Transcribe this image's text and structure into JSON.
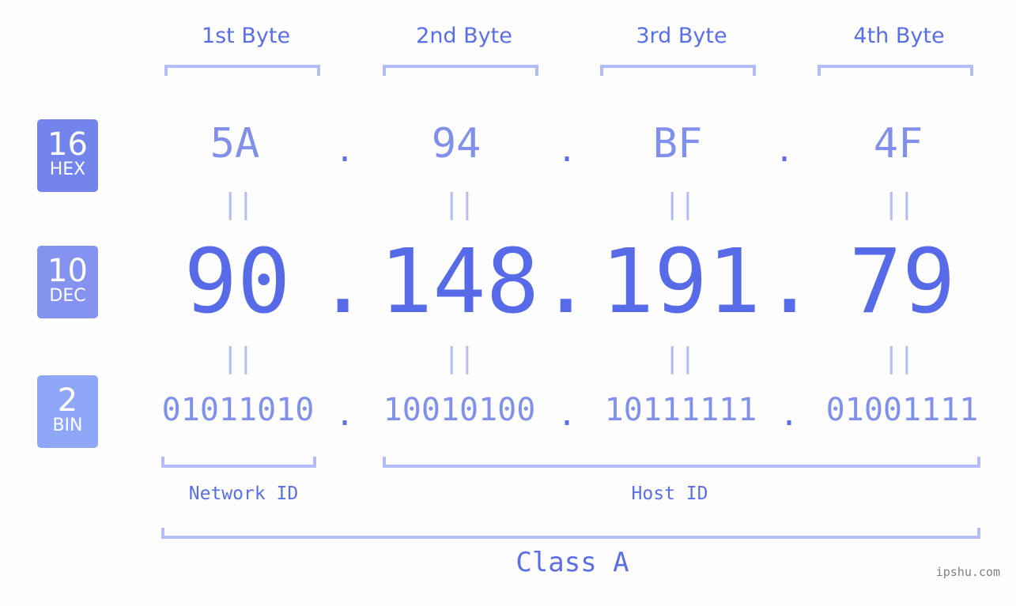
{
  "ip": {
    "bytes": [
      {
        "header": "1st Byte",
        "hex": "5A",
        "dec": "90",
        "bin": "01011010"
      },
      {
        "header": "2nd Byte",
        "hex": "94",
        "dec": "148",
        "bin": "10010100"
      },
      {
        "header": "3rd Byte",
        "hex": "BF",
        "dec": "191",
        "bin": "10111111"
      },
      {
        "header": "4th Byte",
        "hex": "4F",
        "dec": "79",
        "bin": "01001111"
      }
    ],
    "separator": ".",
    "equals": "||"
  },
  "badges": {
    "hex": {
      "base": "16",
      "label": "HEX"
    },
    "dec": {
      "base": "10",
      "label": "DEC"
    },
    "bin": {
      "base": "2",
      "label": "BIN"
    }
  },
  "segments": {
    "network": "Network ID",
    "host": "Host ID",
    "class": "Class A"
  },
  "watermark": "ipshu.com",
  "colors": {
    "accent": "#576be9",
    "light_accent": "#8190eb",
    "bracket": "#b4bcf5",
    "hex_badge": "#7384ec",
    "dec_badge": "#8593f0",
    "bin_badge": "#8ea8f7"
  }
}
